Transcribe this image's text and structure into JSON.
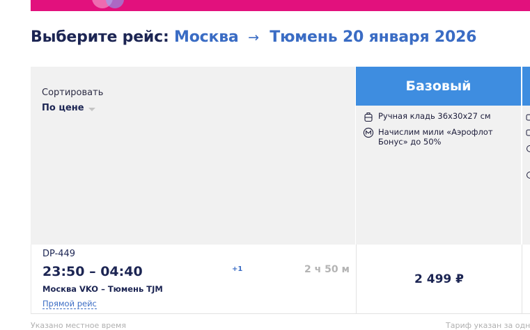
{
  "heading": {
    "label": "Выберите рейс:",
    "origin": "Москва",
    "arrow": "→",
    "destination": "Тюмень",
    "date": "20 января 2026"
  },
  "sort": {
    "caption": "Сортировать",
    "selected": "По цене"
  },
  "tariff": {
    "name": "Базовый",
    "features": [
      {
        "icon": "carry-on-bag-icon",
        "text": "Ручная кладь 36х30х27 см"
      },
      {
        "icon": "miles-icon",
        "text": "Начислим мили «Аэрофлот Бонус» до 50%"
      }
    ]
  },
  "flight": {
    "code": "DP-449",
    "time": "23:50 – 04:40",
    "day_shift": "+1",
    "duration": "2 ч 50 м",
    "route": "Москва VKO – Тюмень TJM",
    "direct_label": "Прямой рейс",
    "price": "2 499 ₽"
  },
  "footer": {
    "left": "Указано местное время",
    "right": "Тариф указан за одного"
  },
  "colors": {
    "banner": "#e2117d",
    "tariff_header": "#3e8de0",
    "heading_text": "#1c2553",
    "accent": "#3a6cc4"
  }
}
